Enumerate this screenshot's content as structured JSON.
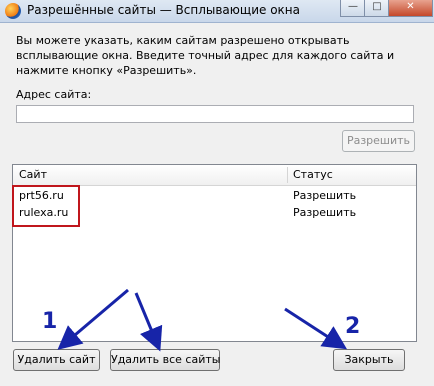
{
  "window": {
    "title": "Разрешённые сайты — Всплывающие окна",
    "min_glyph": "—",
    "max_glyph": "□",
    "close_glyph": "✕"
  },
  "description": "Вы можете указать, каким сайтам разрешено открывать всплывающие окна. Введите точный адрес для каждого сайта и нажмите кнопку «Разрешить».",
  "address": {
    "label": "Адрес сайта:",
    "value": ""
  },
  "allow_button": {
    "label": "Разрешить",
    "enabled": false
  },
  "table": {
    "columns": [
      "Сайт",
      "Статус"
    ],
    "rows": [
      {
        "site": "prt56.ru",
        "status": "Разрешить"
      },
      {
        "site": "rulexa.ru",
        "status": "Разрешить"
      }
    ]
  },
  "buttons": {
    "remove_site": "Удалить сайт",
    "remove_all_sites": "Удалить все сайты",
    "close": "Закрыть"
  },
  "annotations": {
    "marker_1": "1",
    "marker_2": "2",
    "arrow_color": "#1724a8",
    "highlight_color": "#c0161c"
  }
}
